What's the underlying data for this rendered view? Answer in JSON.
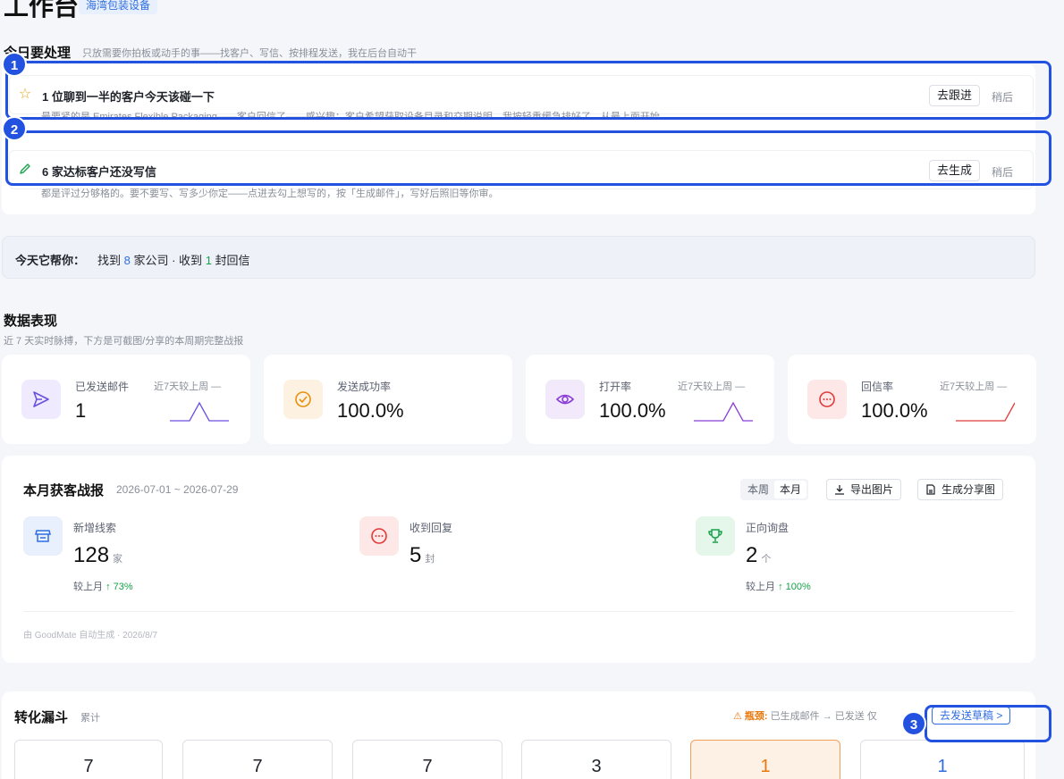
{
  "header": {
    "title": "工作台",
    "company": "海湾包装设备"
  },
  "todo": {
    "title": "今日要处理",
    "subtitle": "只放需要你拍板或动手的事——找客户、写信、按排程发送，我在后台自动干",
    "items": [
      {
        "icon": "star-icon",
        "title": "1 位聊到一半的客户今天该碰一下",
        "desc": "最要紧的是 Emirates Flexible Packaging——客户回信了——感兴趣：客户希望获取设备目录和交期说明，我按轻重缓急排好了，从最上面开始",
        "action": "去跟进",
        "later": "稍后"
      },
      {
        "icon": "pencil-icon",
        "title": "6 家达标客户还没写信",
        "desc": "都是评过分够格的。要不要写、写多少你定——点进去勾上想写的，按「生成邮件」，写好后照旧等你审。",
        "action": "去生成",
        "later": "稍后"
      }
    ]
  },
  "help": {
    "label": "今天它帮你：",
    "found_prefix": "找到",
    "found_count": "8",
    "found_suffix": "家公司 · 收到",
    "reply_count": "1",
    "reply_suffix": "封回信"
  },
  "metrics": {
    "title": "数据表现",
    "subtitle": "近 7 天实时脉搏，下方是可截图/分享的本周期完整战报",
    "kpis": [
      {
        "label": "已发送邮件",
        "value": "1",
        "compare": "近7天较上周 —",
        "icon": "send-icon",
        "color": "#6c4fe0",
        "bg": "#efeafd",
        "spark": [
          0,
          0,
          0,
          1,
          0,
          0,
          0
        ]
      },
      {
        "label": "发送成功率",
        "value": "100.0%",
        "compare": "",
        "icon": "check-circle-icon",
        "color": "#e8900c",
        "bg": "#fdf1e2",
        "spark": []
      },
      {
        "label": "打开率",
        "value": "100.0%",
        "compare": "近7天较上周 —",
        "icon": "eye-icon",
        "color": "#8a3fd6",
        "bg": "#f2eafb",
        "spark": [
          0,
          0,
          0,
          0,
          1,
          0,
          0
        ]
      },
      {
        "label": "回信率",
        "value": "100.0%",
        "compare": "近7天较上周 —",
        "icon": "chat-icon",
        "color": "#e03a3a",
        "bg": "#fde7e7",
        "spark": [
          0,
          0,
          0,
          0,
          0,
          0,
          1
        ]
      }
    ]
  },
  "report": {
    "title": "本月获客战报",
    "range": "2026-07-01 ~ 2026-07-29",
    "tabs": [
      "本周",
      "本月"
    ],
    "active_tab": "本月",
    "export_label": "导出图片",
    "share_label": "生成分享图",
    "stats": [
      {
        "label": "新增线索",
        "value": "128",
        "unit": "家",
        "compare_label": "较上月",
        "compare_value": "73%",
        "icon": "store-icon",
        "color": "#2f6de1",
        "bg": "#e8f0fd"
      },
      {
        "label": "收到回复",
        "value": "5",
        "unit": "封",
        "compare_label": "",
        "compare_value": "",
        "icon": "chat-icon",
        "color": "#e03a3a",
        "bg": "#fde7e7"
      },
      {
        "label": "正向询盘",
        "value": "2",
        "unit": "个",
        "compare_label": "较上月",
        "compare_value": "100%",
        "icon": "trophy-icon",
        "color": "#17a34a",
        "bg": "#e4f7ea"
      }
    ],
    "footnote": "由 GoodMate 自动生成 · 2026/8/7"
  },
  "funnel": {
    "title": "转化漏斗",
    "subtitle": "累计",
    "bottleneck_label": "瓶颈:",
    "bottleneck_text": "已生成邮件 → 已发送 仅",
    "go_draft": "去发送草稿 >",
    "values": [
      "7",
      "7",
      "7",
      "3",
      "1",
      "1"
    ]
  },
  "markers": [
    "1",
    "2",
    "3"
  ]
}
